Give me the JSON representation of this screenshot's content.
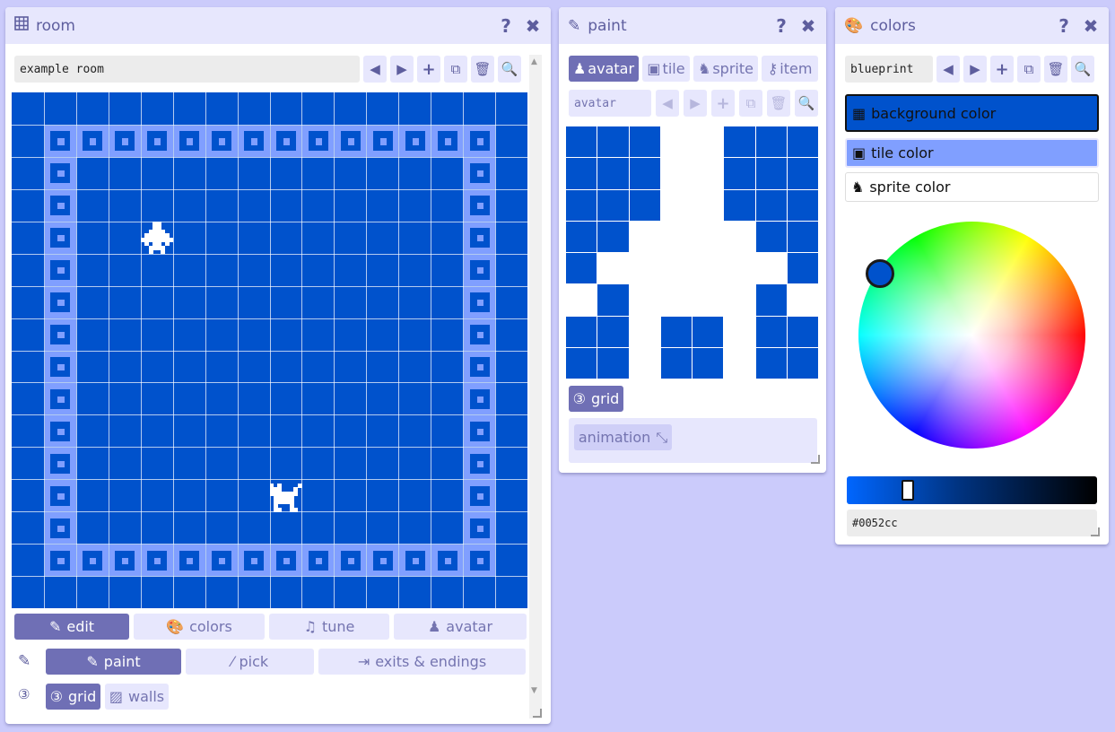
{
  "room_panel": {
    "title": "room",
    "name_value": "example room",
    "tabs": [
      "edit",
      "colors",
      "tune",
      "avatar"
    ],
    "tools": [
      "paint",
      "pick",
      "exits & endings"
    ],
    "toggles": [
      "grid",
      "walls"
    ]
  },
  "paint_panel": {
    "title": "paint",
    "tabs": [
      "avatar",
      "tile",
      "sprite",
      "item"
    ],
    "name_value": "avatar",
    "grid_toggle": "grid",
    "animation_label": "animation",
    "pixels": [
      "11100111",
      "11100111",
      "11100111",
      "11000011",
      "10000001",
      "01000010",
      "11011011",
      "11011011"
    ]
  },
  "colors_panel": {
    "title": "colors",
    "palette_value": "blueprint",
    "swatches": [
      "background color",
      "tile color",
      "sprite color"
    ],
    "hex_value": "#0052cc"
  },
  "colors": {
    "background": "#0052cc",
    "tile": "#809fff",
    "sprite": "#ffffff",
    "ui_accent": "#6f6fb5",
    "ui_light": "#e7e7fd",
    "page_bg": "#cbcbfb"
  },
  "slider": {
    "value_fraction": 0.22
  }
}
